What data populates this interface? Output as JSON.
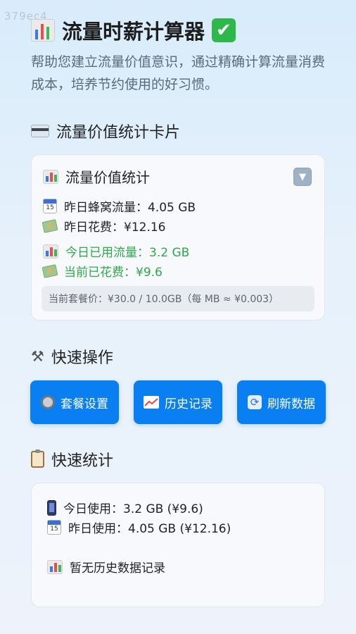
{
  "watermark": "379ec4",
  "header": {
    "title": "流量时薪计算器",
    "subtitle": "帮助您建立流量价值意识，通过精确计算流量消费成本，培养节约使用的好习惯。"
  },
  "value_card_section": {
    "heading": "流量价值统计卡片",
    "card": {
      "title": "流量价值统计",
      "toggle": "▼",
      "rows": [
        {
          "label": "昨日蜂窝流量：4.05 GB"
        },
        {
          "label": "昨日花费：¥12.16"
        },
        {
          "label": "今日已用流量：3.2 GB"
        },
        {
          "label": "当前已花费：¥9.6"
        }
      ],
      "plan_info": "当前套餐价：¥30.0 / 10.0GB（每 MB ≈ ¥0.003）"
    }
  },
  "quick_actions": {
    "heading": "快速操作",
    "buttons": [
      {
        "label": "套餐设置"
      },
      {
        "label": "历史记录"
      },
      {
        "label": "刷新数据"
      }
    ]
  },
  "quick_stats": {
    "heading": "快速统计",
    "today": "今日使用：3.2 GB (¥9.6)",
    "yesterday": "昨日使用：4.05 GB (¥12.16)",
    "history": "暂无历史数据记录"
  },
  "calendar_day": "15",
  "colors": {
    "accent": "#0a7ff2",
    "green_text": "#2ea84a",
    "check_green": "#2fb84a"
  }
}
